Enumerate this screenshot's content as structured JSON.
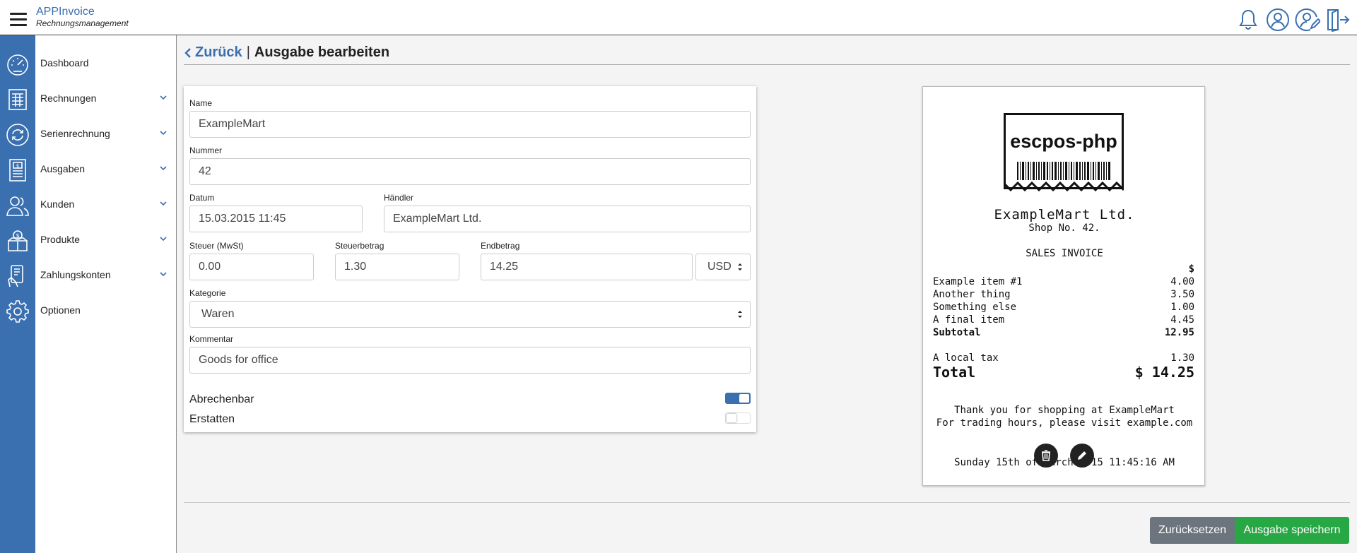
{
  "app": {
    "title": "APPInvoice",
    "subtitle": "Rechnungsmanagement"
  },
  "sidebar": {
    "items": [
      {
        "label": "Dashboard",
        "icon": "speedometer-icon",
        "has_submenu": false
      },
      {
        "label": "Rechnungen",
        "icon": "invoice-sheet-icon",
        "has_submenu": true
      },
      {
        "label": "Serienrechnung",
        "icon": "recurring-arrows-icon",
        "has_submenu": true
      },
      {
        "label": "Ausgaben",
        "icon": "expense-document-icon",
        "has_submenu": true
      },
      {
        "label": "Kunden",
        "icon": "customers-icon",
        "has_submenu": true
      },
      {
        "label": "Produkte",
        "icon": "product-box-icon",
        "has_submenu": true
      },
      {
        "label": "Zahlungskonten",
        "icon": "payment-card-icon",
        "has_submenu": true
      },
      {
        "label": "Optionen",
        "icon": "gear-icon",
        "has_submenu": false
      }
    ]
  },
  "header_icons": [
    "bell-icon",
    "user-icon",
    "user-edit-icon",
    "logout-icon"
  ],
  "page": {
    "back_label": "Zurück",
    "separator": "|",
    "title": "Ausgabe bearbeiten"
  },
  "form": {
    "name": {
      "label": "Name",
      "value": "ExampleMart"
    },
    "number": {
      "label": "Nummer",
      "value": "42"
    },
    "date": {
      "label": "Datum",
      "value": "15.03.2015 11:45"
    },
    "merchant": {
      "label": "Händler",
      "value": "ExampleMart Ltd."
    },
    "tax": {
      "label": "Steuer (MwSt)",
      "value": "0.00"
    },
    "tax_amount": {
      "label": "Steuerbetrag",
      "value": "1.30"
    },
    "total": {
      "label": "Endbetrag",
      "value": "14.25"
    },
    "currency": {
      "value": "USD"
    },
    "category": {
      "label": "Kategorie",
      "value": "Waren"
    },
    "comment": {
      "label": "Kommentar",
      "value": "Goods for office"
    },
    "billable": {
      "label": "Abrechenbar",
      "on": true
    },
    "reimburse": {
      "label": "Erstatten",
      "on": false
    }
  },
  "receipt": {
    "logo_text": "escpos-php",
    "store": "ExampleMart Ltd.",
    "shop": "Shop No. 42.",
    "heading": "SALES INVOICE",
    "currency_symbol": "$",
    "items": [
      {
        "name": "Example item #1",
        "price": "4.00"
      },
      {
        "name": "Another thing",
        "price": "3.50"
      },
      {
        "name": "Something else",
        "price": "1.00"
      },
      {
        "name": "A final item",
        "price": "4.45"
      }
    ],
    "subtotal": {
      "label": "Subtotal",
      "value": "12.95"
    },
    "tax": {
      "label": "A local tax",
      "value": "1.30"
    },
    "total": {
      "label": "Total",
      "value": "$ 14.25"
    },
    "thanks": "Thank you for shopping at ExampleMart",
    "hours": "For trading hours, please visit example.com",
    "date": "Sunday 15th of March 2015 11:45:16 AM"
  },
  "actions": {
    "reset": "Zurücksetzen",
    "save": "Ausgabe speichern"
  },
  "colors": {
    "brand": "#3a6fb0",
    "reset": "#6c757d",
    "save": "#28a745"
  }
}
